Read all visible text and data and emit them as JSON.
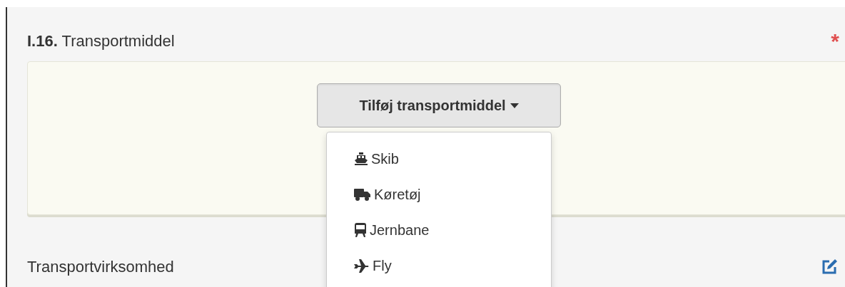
{
  "section": {
    "number": "I.16.",
    "title": "Transportmiddel",
    "required_mark": "*"
  },
  "add_button": {
    "label": "Tilføj transportmiddel",
    "expanded": true
  },
  "menu_items": [
    {
      "kind": "ship",
      "label": "Skib"
    },
    {
      "kind": "truck",
      "label": "Køretøj"
    },
    {
      "kind": "train",
      "label": "Jernbane"
    },
    {
      "kind": "plane",
      "label": "Fly"
    }
  ],
  "next_field": {
    "label": "Transportvirksomhed"
  }
}
